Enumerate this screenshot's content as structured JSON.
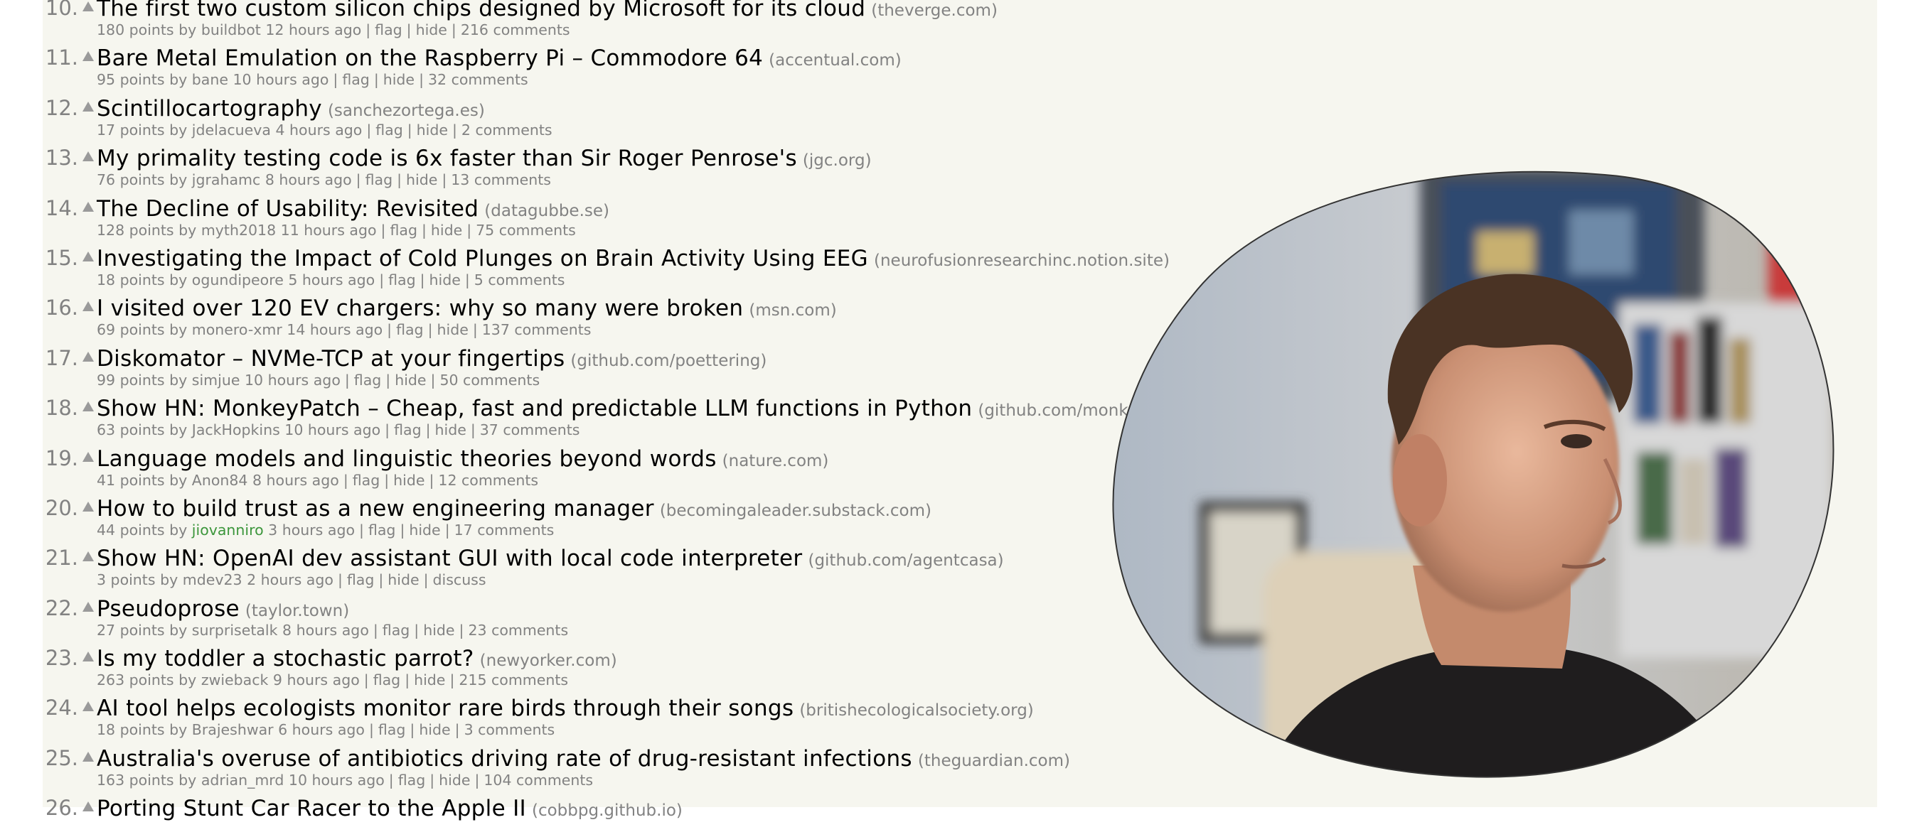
{
  "stories": [
    {
      "rank": "10.",
      "title": "The first two custom silicon chips designed by Microsoft for its cloud",
      "site": "(theverge.com)",
      "points": "180 points",
      "user": "buildbot",
      "age": "12 hours ago",
      "flag": "flag",
      "hide": "hide",
      "comments": "216 comments"
    },
    {
      "rank": "11.",
      "title": "Bare Metal Emulation on the Raspberry Pi – Commodore 64",
      "site": "(accentual.com)",
      "points": "95 points",
      "user": "bane",
      "age": "10 hours ago",
      "flag": "flag",
      "hide": "hide",
      "comments": "32 comments"
    },
    {
      "rank": "12.",
      "title": "Scintillocartography",
      "site": "(sanchezortega.es)",
      "points": "17 points",
      "user": "jdelacueva",
      "age": "4 hours ago",
      "flag": "flag",
      "hide": "hide",
      "comments": "2 comments"
    },
    {
      "rank": "13.",
      "title": "My primality testing code is 6x faster than Sir Roger Penrose's",
      "site": "(jgc.org)",
      "points": "76 points",
      "user": "jgrahamc",
      "age": "8 hours ago",
      "flag": "flag",
      "hide": "hide",
      "comments": "13 comments"
    },
    {
      "rank": "14.",
      "title": "The Decline of Usability: Revisited",
      "site": "(datagubbe.se)",
      "points": "128 points",
      "user": "myth2018",
      "age": "11 hours ago",
      "flag": "flag",
      "hide": "hide",
      "comments": "75 comments"
    },
    {
      "rank": "15.",
      "title": "Investigating the Impact of Cold Plunges on Brain Activity Using EEG",
      "site": "(neurofusionresearchinc.notion.site)",
      "points": "18 points",
      "user": "ogundipeore",
      "age": "5 hours ago",
      "flag": "flag",
      "hide": "hide",
      "comments": "5 comments"
    },
    {
      "rank": "16.",
      "title": "I visited over 120 EV chargers: why so many were broken",
      "site": "(msn.com)",
      "points": "69 points",
      "user": "monero-xmr",
      "age": "14 hours ago",
      "flag": "flag",
      "hide": "hide",
      "comments": "137 comments"
    },
    {
      "rank": "17.",
      "title": "Diskomator – NVMe-TCP at your fingertips",
      "site": "(github.com/poettering)",
      "points": "99 points",
      "user": "simjue",
      "age": "10 hours ago",
      "flag": "flag",
      "hide": "hide",
      "comments": "50 comments"
    },
    {
      "rank": "18.",
      "title": "Show HN: MonkeyPatch – Cheap, fast and predictable LLM functions in Python",
      "site": "(github.com/monkeypatch)",
      "points": "63 points",
      "user": "JackHopkins",
      "age": "10 hours ago",
      "flag": "flag",
      "hide": "hide",
      "comments": "37 comments"
    },
    {
      "rank": "19.",
      "title": "Language models and linguistic theories beyond words",
      "site": "(nature.com)",
      "points": "41 points",
      "user": "Anon84",
      "age": "8 hours ago",
      "flag": "flag",
      "hide": "hide",
      "comments": "12 comments"
    },
    {
      "rank": "20.",
      "title": "How to build trust as a new engineering manager",
      "site": "(becomingaleader.substack.com)",
      "points": "44 points",
      "user": "jiovanniro",
      "user_new": true,
      "age": "3 hours ago",
      "flag": "flag",
      "hide": "hide",
      "comments": "17 comments"
    },
    {
      "rank": "21.",
      "title": "Show HN: OpenAI dev assistant GUI with local code interpreter",
      "site": "(github.com/agentcasa)",
      "points": "3 points",
      "user": "mdev23",
      "age": "2 hours ago",
      "flag": "flag",
      "hide": "hide",
      "comments": "discuss"
    },
    {
      "rank": "22.",
      "title": "Pseudoprose",
      "site": "(taylor.town)",
      "points": "27 points",
      "user": "surprisetalk",
      "age": "8 hours ago",
      "flag": "flag",
      "hide": "hide",
      "comments": "23 comments"
    },
    {
      "rank": "23.",
      "title": "Is my toddler a stochastic parrot?",
      "site": "(newyorker.com)",
      "points": "263 points",
      "user": "zwieback",
      "age": "9 hours ago",
      "flag": "flag",
      "hide": "hide",
      "comments": "215 comments"
    },
    {
      "rank": "24.",
      "title": "AI tool helps ecologists monitor rare birds through their songs",
      "site": "(britishecologicalsociety.org)",
      "points": "18 points",
      "user": "Brajeshwar",
      "age": "6 hours ago",
      "flag": "flag",
      "hide": "hide",
      "comments": "3 comments"
    },
    {
      "rank": "25.",
      "title": "Australia's overuse of antibiotics driving rate of drug-resistant infections",
      "site": "(theguardian.com)",
      "points": "163 points",
      "user": "adrian_mrd",
      "age": "10 hours ago",
      "flag": "flag",
      "hide": "hide",
      "comments": "104 comments"
    },
    {
      "rank": "26.",
      "title": "Porting Stunt Car Racer to the Apple II",
      "site": "(cobbpg.github.io)",
      "points": "",
      "user": "",
      "age": "",
      "flag": "",
      "hide": "",
      "comments": ""
    }
  ],
  "labels": {
    "by": "by",
    "separator": "|"
  },
  "colors": {
    "page_bg": "#f6f6ef",
    "subtext": "#828282",
    "new_user": "#3c963c",
    "title": "#000000"
  }
}
